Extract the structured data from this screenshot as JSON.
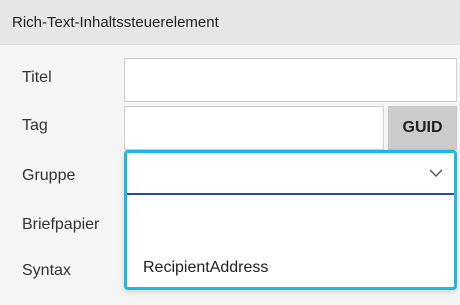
{
  "header": {
    "title": "Rich-Text-Inhaltssteuerelement"
  },
  "fields": {
    "titel": {
      "label": "Titel",
      "value": ""
    },
    "tag": {
      "label": "Tag",
      "value": "",
      "guid_button": "GUID"
    },
    "gruppe": {
      "label": "Gruppe",
      "selected": "",
      "chevron_icon": "chevron-down-icon"
    },
    "briefpapier": {
      "label": "Briefpapier"
    },
    "syntax": {
      "label": "Syntax"
    }
  },
  "dropdown": {
    "options": [
      "",
      "RecipientAddress"
    ]
  },
  "colors": {
    "focus_border": "#1eb9e0",
    "select_underline": "#2b4c9a",
    "guid_bg": "#cccccc",
    "header_bg": "#e6e6e6"
  }
}
